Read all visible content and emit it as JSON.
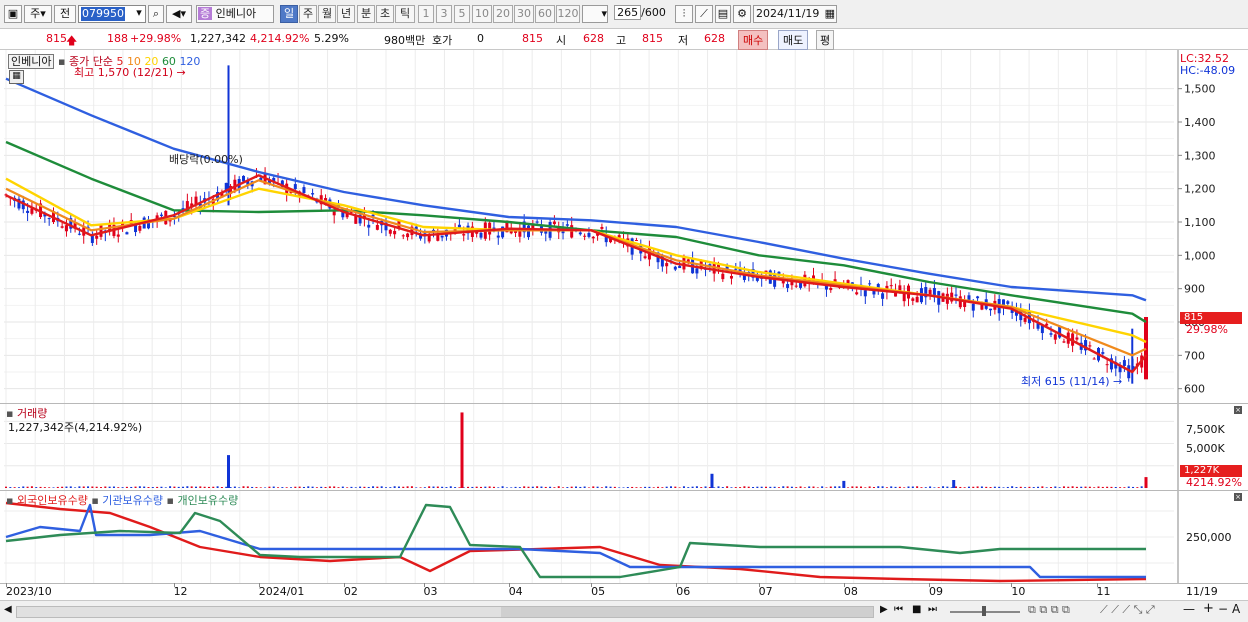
{
  "toolbar": {
    "market_label": "주",
    "prev_label": "전",
    "stock_code": "079950",
    "stock_badge": "증",
    "stock_name": "인베니아",
    "period_day": "일",
    "period_week": "주",
    "period_month": "월",
    "period_year": "년",
    "period_minute": "분",
    "period_second": "초",
    "period_tick": "틱",
    "intervals": [
      "1",
      "3",
      "5",
      "10",
      "20",
      "30",
      "60",
      "120"
    ],
    "count": "265",
    "count_max": "/600",
    "date": "2024/11/19"
  },
  "quote": {
    "price": "815",
    "change": "188",
    "change_pct": "+29.98%",
    "volume": "1,227,342",
    "volume_pct": "4,214.92%",
    "turnover": "5.29%",
    "amount": "980백만",
    "hoga_label": "호가",
    "hoga_value": "0",
    "hoga_price": "815",
    "open_label": "시",
    "open": "628",
    "high_label": "고",
    "high": "815",
    "low_label": "저",
    "low": "628",
    "buy_label": "매수",
    "sell_label": "매도",
    "eval_label": "평"
  },
  "price_pane": {
    "name_tag": "인베니아",
    "ma_label": "종가 단순",
    "ma_periods": [
      "5",
      "10",
      "20",
      "60",
      "120"
    ],
    "ma_colors": [
      "#e01b1b",
      "#f08a1c",
      "#ffd400",
      "#1e8c3a",
      "#2f5fe0"
    ],
    "lc": "LC:32.52",
    "hc": "HC:-48.09",
    "high_annotation": "최고 1,570 (12/21)",
    "low_annotation": "최저 615 (11/14)",
    "dividend_note": "배당락(0.00%)",
    "last_price_tag": "815",
    "last_change_tag": "29.98%"
  },
  "volume_pane": {
    "title": "거래량",
    "readout": "1,227,342주(4,214.92%)",
    "ticks": [
      "7,500K",
      "5,000K"
    ],
    "last_tag": "1,227K",
    "last_pct_tag": "4214.92%"
  },
  "holdings_pane": {
    "series_labels": [
      "외국인보유수량",
      "기관보유수량",
      "개인보유수량"
    ],
    "series_colors": [
      "#e01b1b",
      "#2f5fe0",
      "#2e8b57"
    ],
    "tick": "250,000"
  },
  "x_axis_labels": [
    "2023/10",
    "12",
    "2024/01",
    "02",
    "03",
    "04",
    "05",
    "06",
    "07",
    "08",
    "09",
    "10",
    "11",
    "11/19"
  ],
  "colors": {
    "up": "#e0001b",
    "down": "#1034d6",
    "grid": "#e3e3e3",
    "price_tag_bg": "#e61e1e"
  },
  "chart_data": {
    "type": "line",
    "title": "",
    "y_ticks": [
      1500,
      1400,
      1300,
      1200,
      1100,
      1000,
      900,
      800,
      700,
      600
    ],
    "ylim": [
      560,
      1610
    ],
    "series": [
      {
        "name": "종가 단순 5",
        "x": [
          "2023/10",
          "2023/11",
          "2023/12",
          "2024/01",
          "2024/02",
          "2024/03",
          "2024/04",
          "2024/05",
          "2024/06",
          "2024/07",
          "2024/08",
          "2024/09",
          "2024/10",
          "2024/11/14",
          "2024/11/19"
        ],
        "values": [
          1180,
          1060,
          1120,
          1240,
          1130,
          1060,
          1080,
          1075,
          975,
          935,
          905,
          880,
          840,
          650,
          700
        ]
      },
      {
        "name": "종가 단순 10",
        "x": [
          "2023/10",
          "2023/11",
          "2023/12",
          "2024/01",
          "2024/02",
          "2024/03",
          "2024/04",
          "2024/05",
          "2024/06",
          "2024/07",
          "2024/08",
          "2024/09",
          "2024/10",
          "2024/11/14",
          "2024/11/19"
        ],
        "values": [
          1200,
          1075,
          1110,
          1225,
          1140,
          1070,
          1075,
          1075,
          985,
          940,
          910,
          880,
          845,
          700,
          720
        ]
      },
      {
        "name": "종가 단순 20",
        "x": [
          "2023/10",
          "2023/11",
          "2023/12",
          "2024/01",
          "2024/02",
          "2024/03",
          "2024/04",
          "2024/05",
          "2024/06",
          "2024/07",
          "2024/08",
          "2024/09",
          "2024/10",
          "2024/11/14",
          "2024/11/19"
        ],
        "values": [
          1230,
          1090,
          1110,
          1200,
          1150,
          1085,
          1075,
          1075,
          1000,
          950,
          915,
          880,
          845,
          760,
          740
        ]
      },
      {
        "name": "종가 단순 60",
        "x": [
          "2023/10",
          "2023/11",
          "2023/12",
          "2024/01",
          "2024/02",
          "2024/03",
          "2024/04",
          "2024/05",
          "2024/06",
          "2024/07",
          "2024/08",
          "2024/09",
          "2024/10",
          "2024/11/14",
          "2024/11/19"
        ],
        "values": [
          1340,
          1230,
          1135,
          1130,
          1135,
          1120,
          1100,
          1075,
          1055,
          1000,
          970,
          920,
          880,
          825,
          800
        ]
      },
      {
        "name": "종가 단순 120",
        "x": [
          "2023/10",
          "2023/11",
          "2023/12",
          "2024/01",
          "2024/02",
          "2024/03",
          "2024/04",
          "2024/05",
          "2024/06",
          "2024/07",
          "2024/08",
          "2024/09",
          "2024/10",
          "2024/11/14",
          "2024/11/19"
        ],
        "values": [
          1530,
          1420,
          1320,
          1250,
          1190,
          1150,
          1115,
          1105,
          1085,
          1040,
          990,
          945,
          905,
          880,
          865
        ]
      }
    ],
    "high": {
      "date": "12/21",
      "value": 1570
    },
    "low": {
      "date": "11/14",
      "value": 615
    },
    "last_close": 815,
    "volume_spikes": [
      {
        "x": "2023/12",
        "value": 3700
      },
      {
        "x": "2024/03",
        "value": 8500
      },
      {
        "x": "2024/06",
        "value": 1600
      },
      {
        "x": "2024/08",
        "value": 800
      },
      {
        "x": "2024/09",
        "value": 900
      },
      {
        "x": "2024/11/19",
        "value": 1227
      }
    ]
  }
}
